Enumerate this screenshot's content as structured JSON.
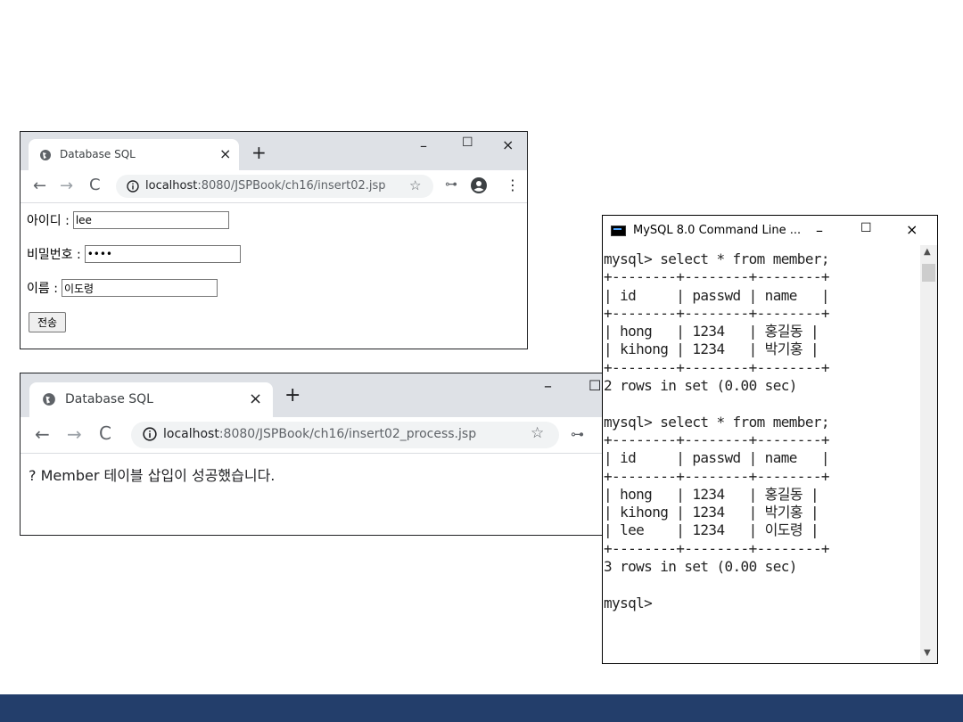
{
  "browser1": {
    "tab_title": "Database SQL",
    "url_host": "localhost",
    "url_path": ":8080/JSPBook/ch16/insert02.jsp",
    "form": {
      "id_label": "아이디 :",
      "id_value": "lee",
      "password_label": "비밀번호 :",
      "password_value": "1234",
      "name_label": "이름 :",
      "name_value": "이도령",
      "submit_label": "전송"
    }
  },
  "browser2": {
    "tab_title": "Database SQL",
    "url_host": "localhost",
    "url_path": ":8080/JSPBook/ch16/insert02_process.jsp",
    "message": "? Member 테이블 삽입이 성공했습니다."
  },
  "console": {
    "title": "MySQL 8.0 Command Line ...",
    "output": "mysql> select * from member;\n+--------+--------+--------+\n| id     | passwd | name   |\n+--------+--------+--------+\n| hong   | 1234   | 홍길동 |\n| kihong | 1234   | 박기홍 |\n+--------+--------+--------+\n2 rows in set (0.00 sec)\n\nmysql> select * from member;\n+--------+--------+--------+\n| id     | passwd | name   |\n+--------+--------+--------+\n| hong   | 1234   | 홍길동 |\n| kihong | 1234   | 박기홍 |\n| lee    | 1234   | 이도령 |\n+--------+--------+--------+\n3 rows in set (0.00 sec)\n\nmysql>"
  },
  "icons": {
    "back": "←",
    "forward": "→",
    "reload": "C",
    "info": "ⓘ",
    "star": "☆",
    "key": "⊶",
    "kebab": "⋮",
    "close": "×",
    "newtab": "+",
    "minimize": "–",
    "maximize": "☐"
  },
  "colors": {
    "footer": "#233e6b",
    "tabstrip": "#dee1e6",
    "omnibox": "#f1f3f4"
  }
}
